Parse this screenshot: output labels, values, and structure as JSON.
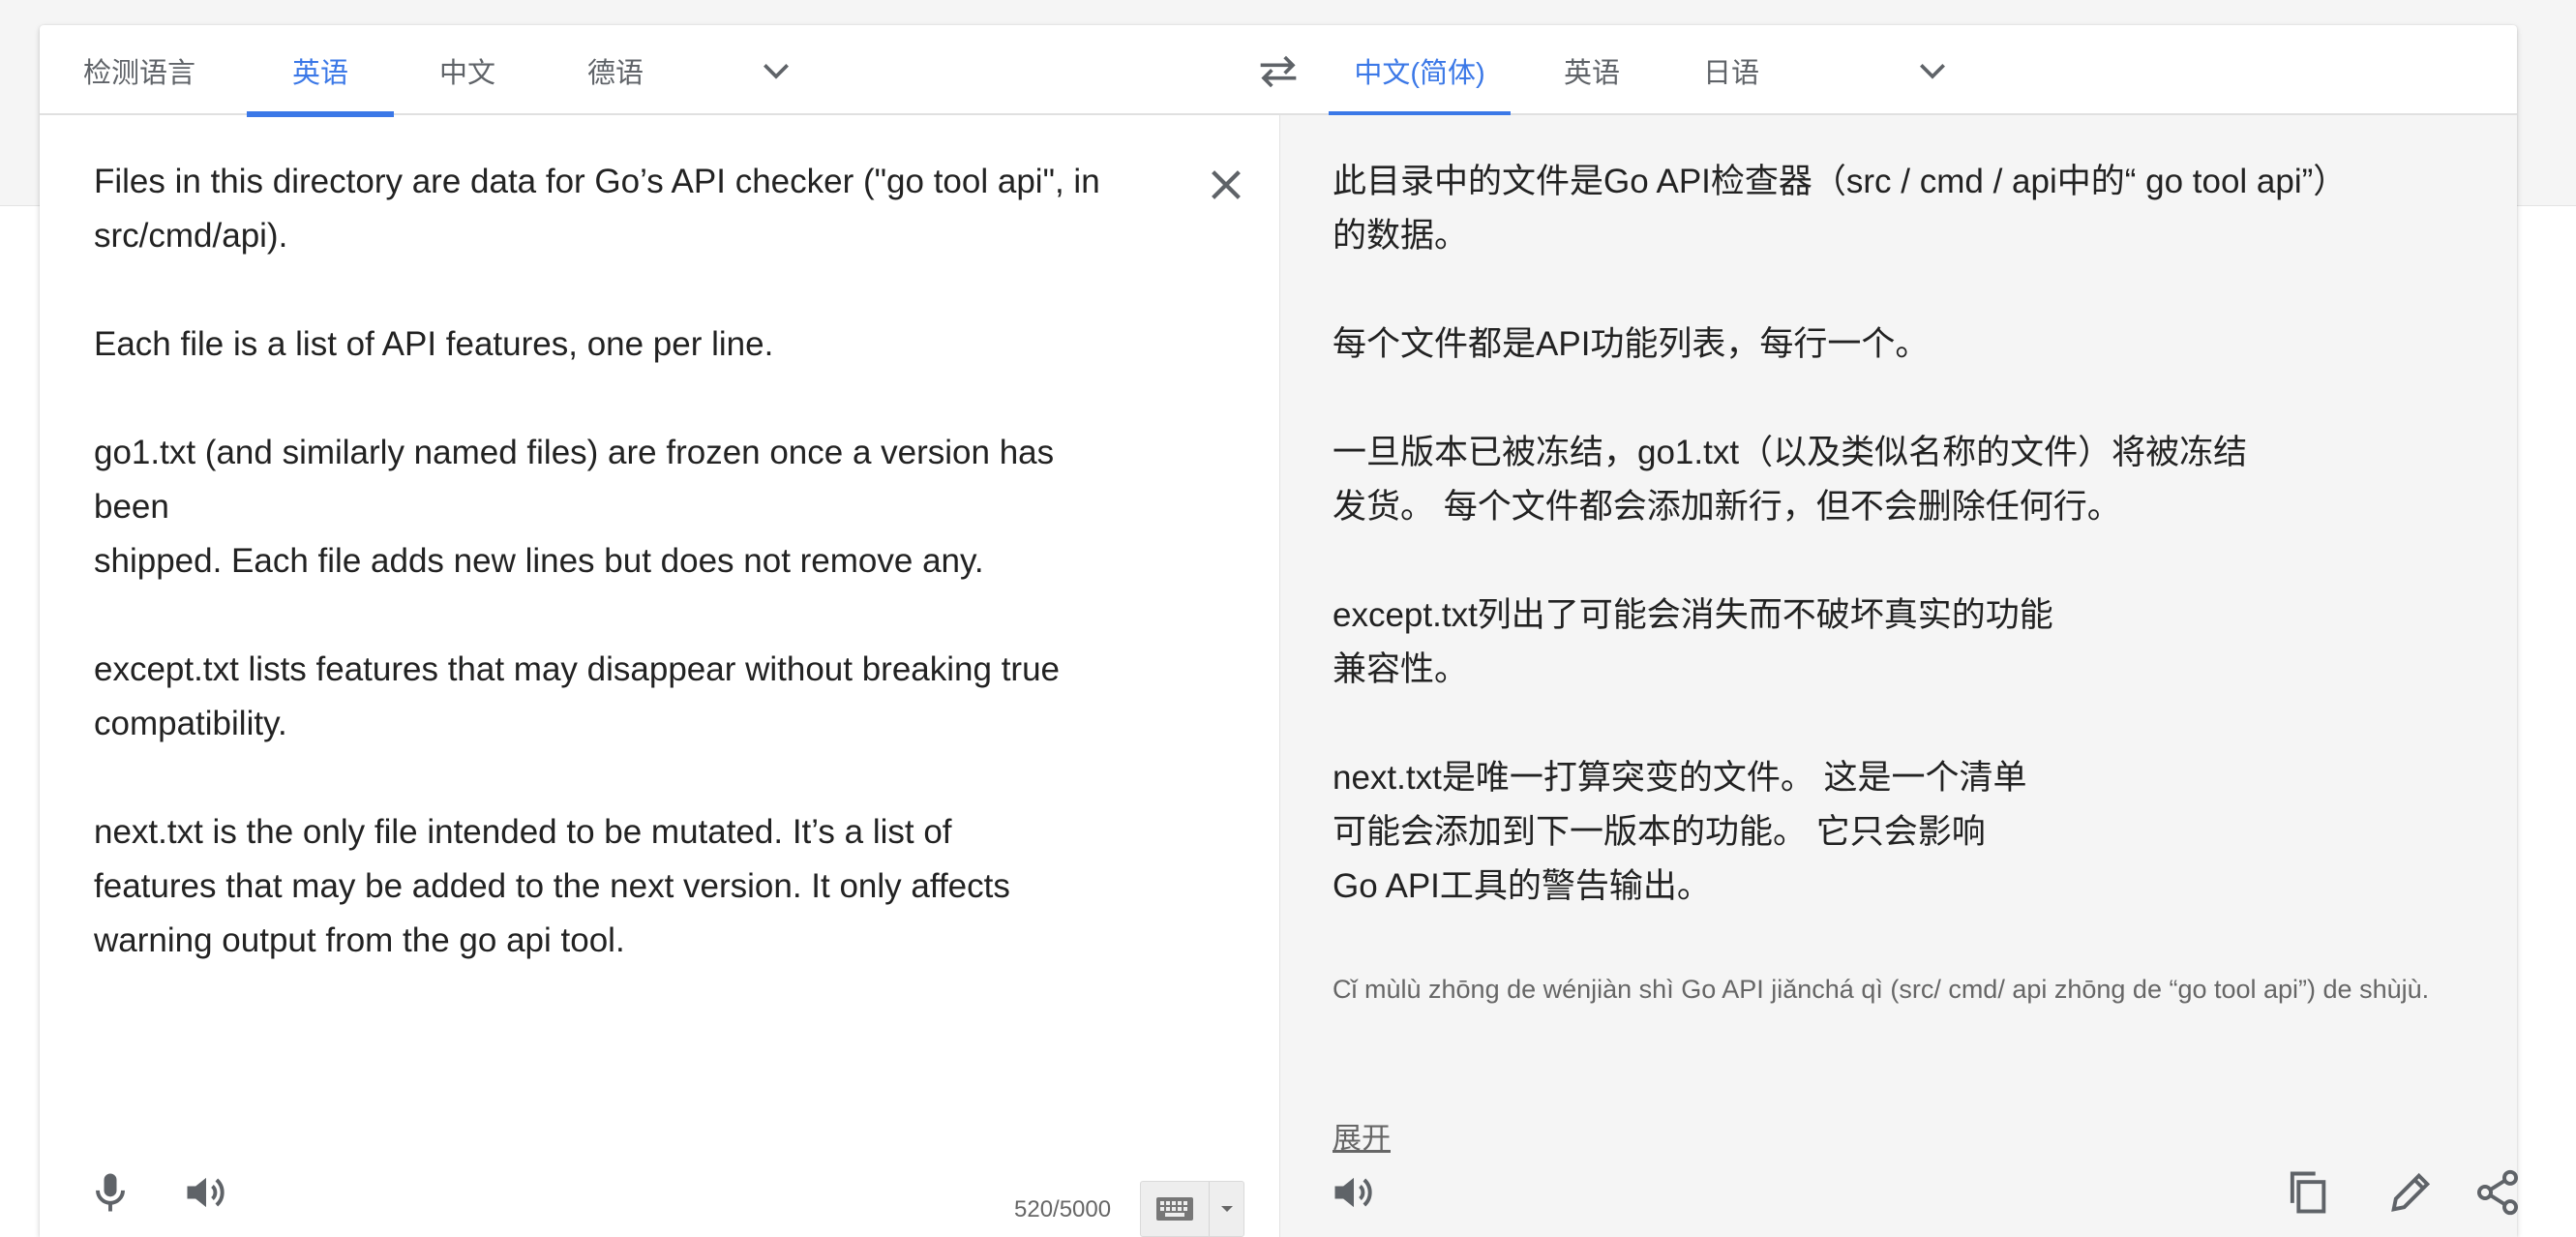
{
  "source_tabs": [
    "检测语言",
    "英语",
    "中文",
    "德语"
  ],
  "target_tabs": [
    "中文(简体)",
    "英语",
    "日语"
  ],
  "source_text": {
    "p1a": "Files in this directory are data for Go’s API checker (\"go tool api\", in",
    "p1b": "src/cmd/api).",
    "p2": "Each file is a list of API features, one per line.",
    "p3a": "go1.txt (and similarly named files) are frozen once a version has",
    "p3b": "been",
    "p3c": "shipped. Each file adds new lines but does not remove any.",
    "p4a": "except.txt lists features that may disappear without breaking true",
    "p4b": "compatibility.",
    "p5a": "next.txt is the only file intended to be mutated. It’s a list of",
    "p5b": "features that may be added to the next version. It only affects",
    "p5c": "warning output from the go api tool."
  },
  "target_text": {
    "p1a": "此目录中的文件是Go API检查器（src / cmd / api中的“ go tool api”）",
    "p1b": "的数据。",
    "p2": "每个文件都是API功能列表，每行一个。",
    "p3a": "一旦版本已被冻结，go1.txt（以及类似名称的文件）将被冻结",
    "p3b": "发货。 每个文件都会添加新行，但不会删除任何行。",
    "p4a": "except.txt列出了可能会消失而不破坏真实的功能",
    "p4b": "兼容性。",
    "p5a": "next.txt是唯一打算突变的文件。 这是一个清单",
    "p5b": "可能会添加到下一版本的功能。 它只会影响",
    "p5c": "Go API工具的警告输出。"
  },
  "romanization": "Cǐ mùlù zhōng de wénjiàn shì Go API jiǎnchá qì (src/ cmd/ api zhōng de “go tool api”) de shùjù.",
  "expand_label": "展开",
  "char_count": "520/5000",
  "accent_color": "#3b78e7",
  "icons": [
    "chevron-down-icon",
    "swap-icon",
    "close-icon",
    "microphone-icon",
    "speaker-icon",
    "keyboard-icon",
    "copy-icon",
    "edit-icon",
    "share-icon"
  ]
}
